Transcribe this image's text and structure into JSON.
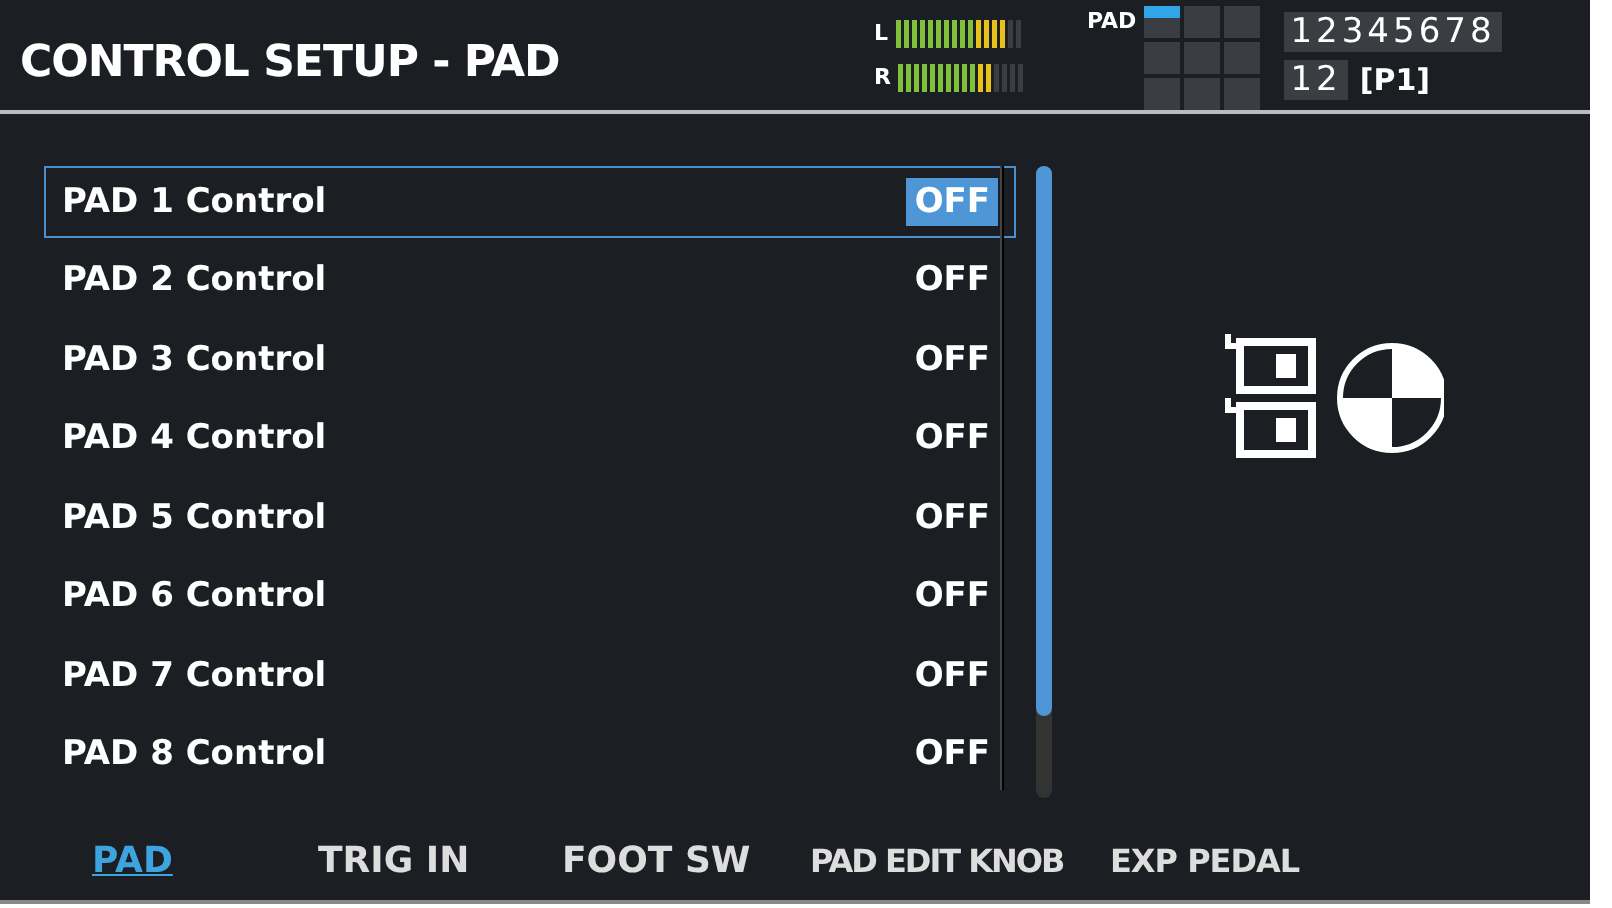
{
  "title": "CONTROL SETUP - PAD",
  "meters": [
    {
      "label": "L",
      "level": 0.85
    },
    {
      "label": "R",
      "level": 0.75
    }
  ],
  "pad_indicator": {
    "label": "PAD"
  },
  "numbers": [
    "1",
    "2",
    "3",
    "4",
    "5",
    "6",
    "7",
    "8"
  ],
  "banks": [
    "1",
    "2"
  ],
  "page": "[P1]",
  "rows": [
    {
      "label": "PAD 1 Control",
      "value": "OFF",
      "selected": true
    },
    {
      "label": "PAD 2 Control",
      "value": "OFF",
      "selected": false
    },
    {
      "label": "PAD 3 Control",
      "value": "OFF",
      "selected": false
    },
    {
      "label": "PAD 4 Control",
      "value": "OFF",
      "selected": false
    },
    {
      "label": "PAD 5 Control",
      "value": "OFF",
      "selected": false
    },
    {
      "label": "PAD 6 Control",
      "value": "OFF",
      "selected": false
    },
    {
      "label": "PAD 7 Control",
      "value": "OFF",
      "selected": false
    },
    {
      "label": "PAD 8 Control",
      "value": "OFF",
      "selected": false
    }
  ],
  "tabs": [
    {
      "label": "PAD",
      "selected": true
    },
    {
      "label": "TRIG IN",
      "selected": false
    },
    {
      "label": "FOOT SW",
      "selected": false
    },
    {
      "label": "PAD EDIT KNOB",
      "selected": false
    },
    {
      "label": "EXP PEDAL",
      "selected": false
    }
  ]
}
